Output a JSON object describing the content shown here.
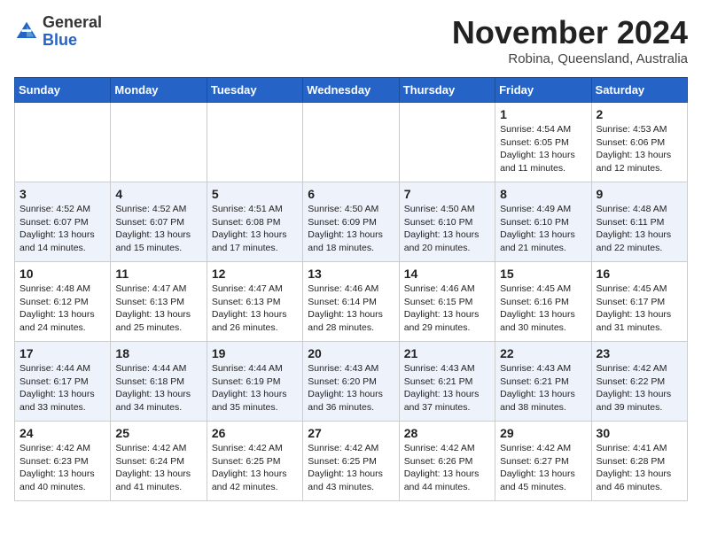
{
  "header": {
    "logo_general": "General",
    "logo_blue": "Blue",
    "month_title": "November 2024",
    "location": "Robina, Queensland, Australia"
  },
  "days_of_week": [
    "Sunday",
    "Monday",
    "Tuesday",
    "Wednesday",
    "Thursday",
    "Friday",
    "Saturday"
  ],
  "weeks": [
    [
      {
        "day": "",
        "info": ""
      },
      {
        "day": "",
        "info": ""
      },
      {
        "day": "",
        "info": ""
      },
      {
        "day": "",
        "info": ""
      },
      {
        "day": "",
        "info": ""
      },
      {
        "day": "1",
        "info": "Sunrise: 4:54 AM\nSunset: 6:05 PM\nDaylight: 13 hours\nand 11 minutes."
      },
      {
        "day": "2",
        "info": "Sunrise: 4:53 AM\nSunset: 6:06 PM\nDaylight: 13 hours\nand 12 minutes."
      }
    ],
    [
      {
        "day": "3",
        "info": "Sunrise: 4:52 AM\nSunset: 6:07 PM\nDaylight: 13 hours\nand 14 minutes."
      },
      {
        "day": "4",
        "info": "Sunrise: 4:52 AM\nSunset: 6:07 PM\nDaylight: 13 hours\nand 15 minutes."
      },
      {
        "day": "5",
        "info": "Sunrise: 4:51 AM\nSunset: 6:08 PM\nDaylight: 13 hours\nand 17 minutes."
      },
      {
        "day": "6",
        "info": "Sunrise: 4:50 AM\nSunset: 6:09 PM\nDaylight: 13 hours\nand 18 minutes."
      },
      {
        "day": "7",
        "info": "Sunrise: 4:50 AM\nSunset: 6:10 PM\nDaylight: 13 hours\nand 20 minutes."
      },
      {
        "day": "8",
        "info": "Sunrise: 4:49 AM\nSunset: 6:10 PM\nDaylight: 13 hours\nand 21 minutes."
      },
      {
        "day": "9",
        "info": "Sunrise: 4:48 AM\nSunset: 6:11 PM\nDaylight: 13 hours\nand 22 minutes."
      }
    ],
    [
      {
        "day": "10",
        "info": "Sunrise: 4:48 AM\nSunset: 6:12 PM\nDaylight: 13 hours\nand 24 minutes."
      },
      {
        "day": "11",
        "info": "Sunrise: 4:47 AM\nSunset: 6:13 PM\nDaylight: 13 hours\nand 25 minutes."
      },
      {
        "day": "12",
        "info": "Sunrise: 4:47 AM\nSunset: 6:13 PM\nDaylight: 13 hours\nand 26 minutes."
      },
      {
        "day": "13",
        "info": "Sunrise: 4:46 AM\nSunset: 6:14 PM\nDaylight: 13 hours\nand 28 minutes."
      },
      {
        "day": "14",
        "info": "Sunrise: 4:46 AM\nSunset: 6:15 PM\nDaylight: 13 hours\nand 29 minutes."
      },
      {
        "day": "15",
        "info": "Sunrise: 4:45 AM\nSunset: 6:16 PM\nDaylight: 13 hours\nand 30 minutes."
      },
      {
        "day": "16",
        "info": "Sunrise: 4:45 AM\nSunset: 6:17 PM\nDaylight: 13 hours\nand 31 minutes."
      }
    ],
    [
      {
        "day": "17",
        "info": "Sunrise: 4:44 AM\nSunset: 6:17 PM\nDaylight: 13 hours\nand 33 minutes."
      },
      {
        "day": "18",
        "info": "Sunrise: 4:44 AM\nSunset: 6:18 PM\nDaylight: 13 hours\nand 34 minutes."
      },
      {
        "day": "19",
        "info": "Sunrise: 4:44 AM\nSunset: 6:19 PM\nDaylight: 13 hours\nand 35 minutes."
      },
      {
        "day": "20",
        "info": "Sunrise: 4:43 AM\nSunset: 6:20 PM\nDaylight: 13 hours\nand 36 minutes."
      },
      {
        "day": "21",
        "info": "Sunrise: 4:43 AM\nSunset: 6:21 PM\nDaylight: 13 hours\nand 37 minutes."
      },
      {
        "day": "22",
        "info": "Sunrise: 4:43 AM\nSunset: 6:21 PM\nDaylight: 13 hours\nand 38 minutes."
      },
      {
        "day": "23",
        "info": "Sunrise: 4:42 AM\nSunset: 6:22 PM\nDaylight: 13 hours\nand 39 minutes."
      }
    ],
    [
      {
        "day": "24",
        "info": "Sunrise: 4:42 AM\nSunset: 6:23 PM\nDaylight: 13 hours\nand 40 minutes."
      },
      {
        "day": "25",
        "info": "Sunrise: 4:42 AM\nSunset: 6:24 PM\nDaylight: 13 hours\nand 41 minutes."
      },
      {
        "day": "26",
        "info": "Sunrise: 4:42 AM\nSunset: 6:25 PM\nDaylight: 13 hours\nand 42 minutes."
      },
      {
        "day": "27",
        "info": "Sunrise: 4:42 AM\nSunset: 6:25 PM\nDaylight: 13 hours\nand 43 minutes."
      },
      {
        "day": "28",
        "info": "Sunrise: 4:42 AM\nSunset: 6:26 PM\nDaylight: 13 hours\nand 44 minutes."
      },
      {
        "day": "29",
        "info": "Sunrise: 4:42 AM\nSunset: 6:27 PM\nDaylight: 13 hours\nand 45 minutes."
      },
      {
        "day": "30",
        "info": "Sunrise: 4:41 AM\nSunset: 6:28 PM\nDaylight: 13 hours\nand 46 minutes."
      }
    ]
  ]
}
